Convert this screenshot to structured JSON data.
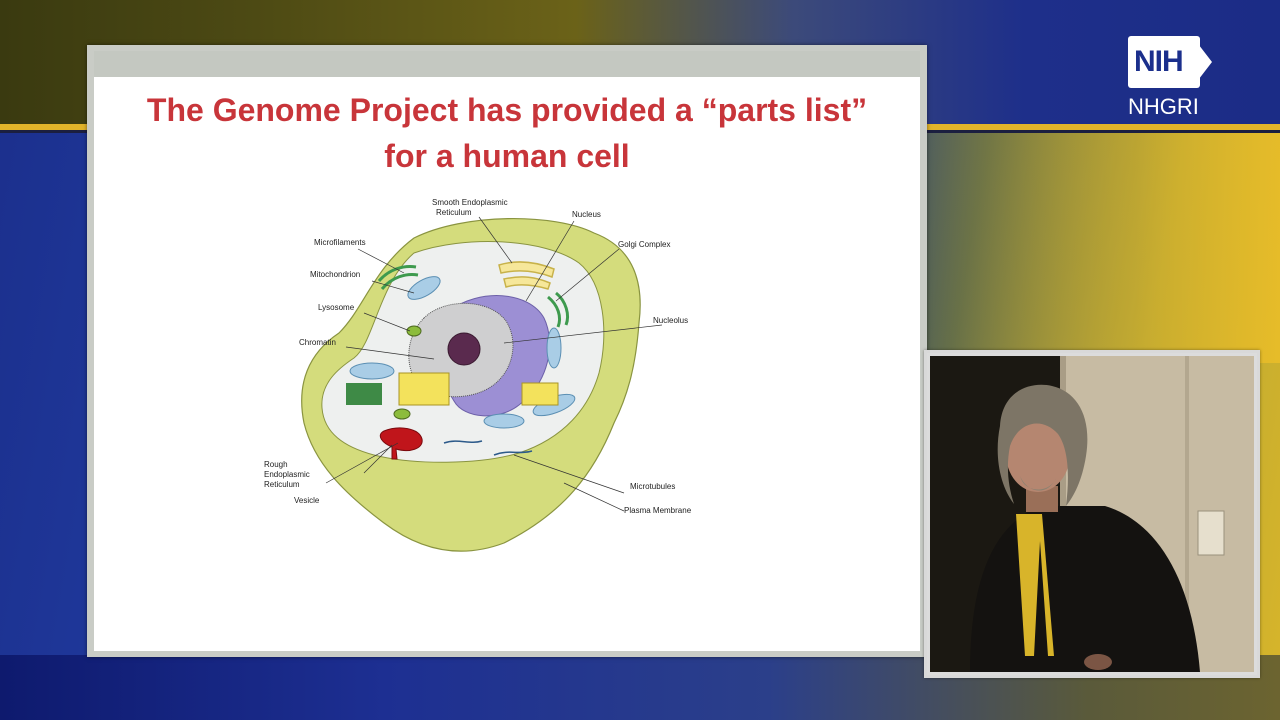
{
  "logo": {
    "mark": "NIH",
    "sub": "NHGRI"
  },
  "slide": {
    "title_line1": "The Genome Project has provided a “parts list”",
    "title_line2": "for a human cell",
    "labels": {
      "smooth_er": [
        "Smooth Endoplasmic",
        "Reticulum"
      ],
      "nucleus": "Nucleus",
      "golgi": "Golgi Complex",
      "microfilaments": "Microfilaments",
      "mitochondrion": "Mitochondrion",
      "lysosome": "Lysosome",
      "chromatin": "Chromatin",
      "nucleolus": "Nucleolus",
      "rough_er": [
        "Rough",
        "Endoplasmic",
        "Reticulum"
      ],
      "vesicle": "Vesicle",
      "microtubules": "Microtubules",
      "plasma_membrane": "Plasma Membrane"
    }
  },
  "speaker_video": {
    "icon": "speaker-video"
  },
  "colors": {
    "title": "#c8353a",
    "band": "#e2b42a",
    "cytoplasm": "#d4dc7c",
    "nucleus_envelope": "#9c8fd4"
  }
}
